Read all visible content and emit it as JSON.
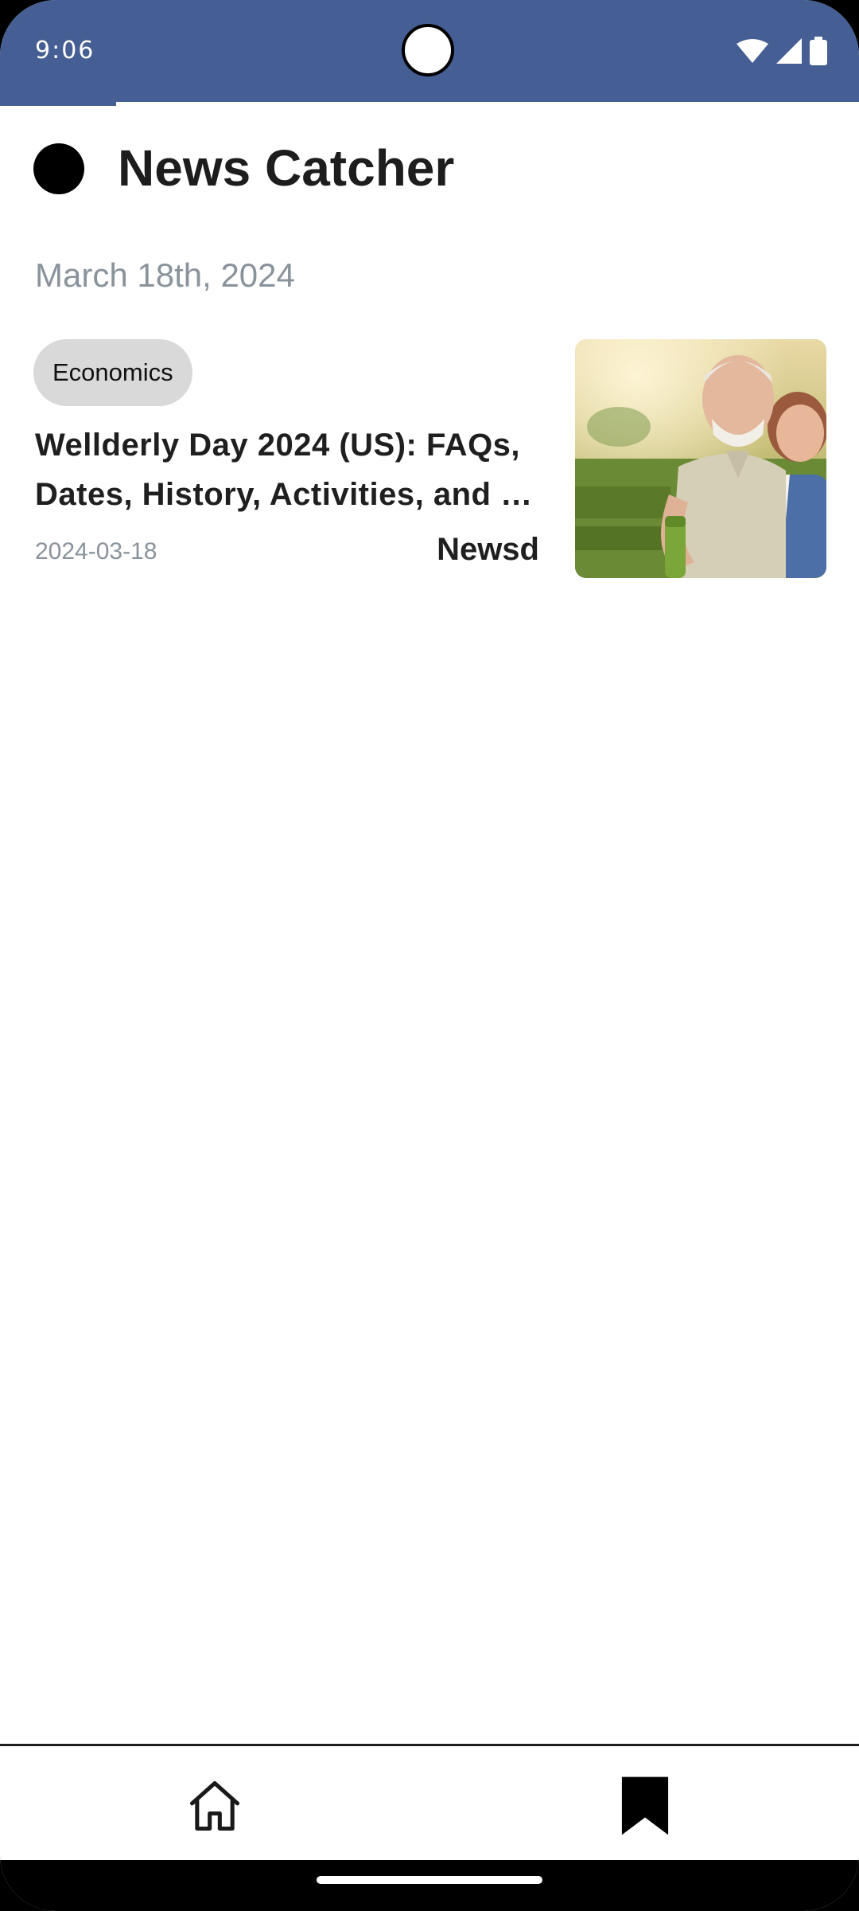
{
  "status_bar": {
    "time": "9:06",
    "background": "#455e93",
    "load_progress": 0.135,
    "icons": [
      "wifi-icon",
      "cellular-signal-icon",
      "battery-icon"
    ]
  },
  "header": {
    "title": "News Catcher",
    "logo_icon": "black-dot-logo"
  },
  "date_heading": "March 18th, 2024",
  "articles": [
    {
      "category": "Economics",
      "title": "Wellderly Day 2024 (US): FAQs, Dates, History, Activities, and …",
      "date": "2024-03-18",
      "source": "Newsd",
      "thumbnail": "photo of smiling elderly couple outdoors"
    }
  ],
  "bottom_nav": {
    "items": [
      {
        "icon": "home-outline-icon"
      },
      {
        "icon": "bookmark-filled-icon"
      }
    ]
  },
  "colors": {
    "accent": "#455e93",
    "chip_bg": "#d9d9d9",
    "muted_text": "#8a939c"
  }
}
